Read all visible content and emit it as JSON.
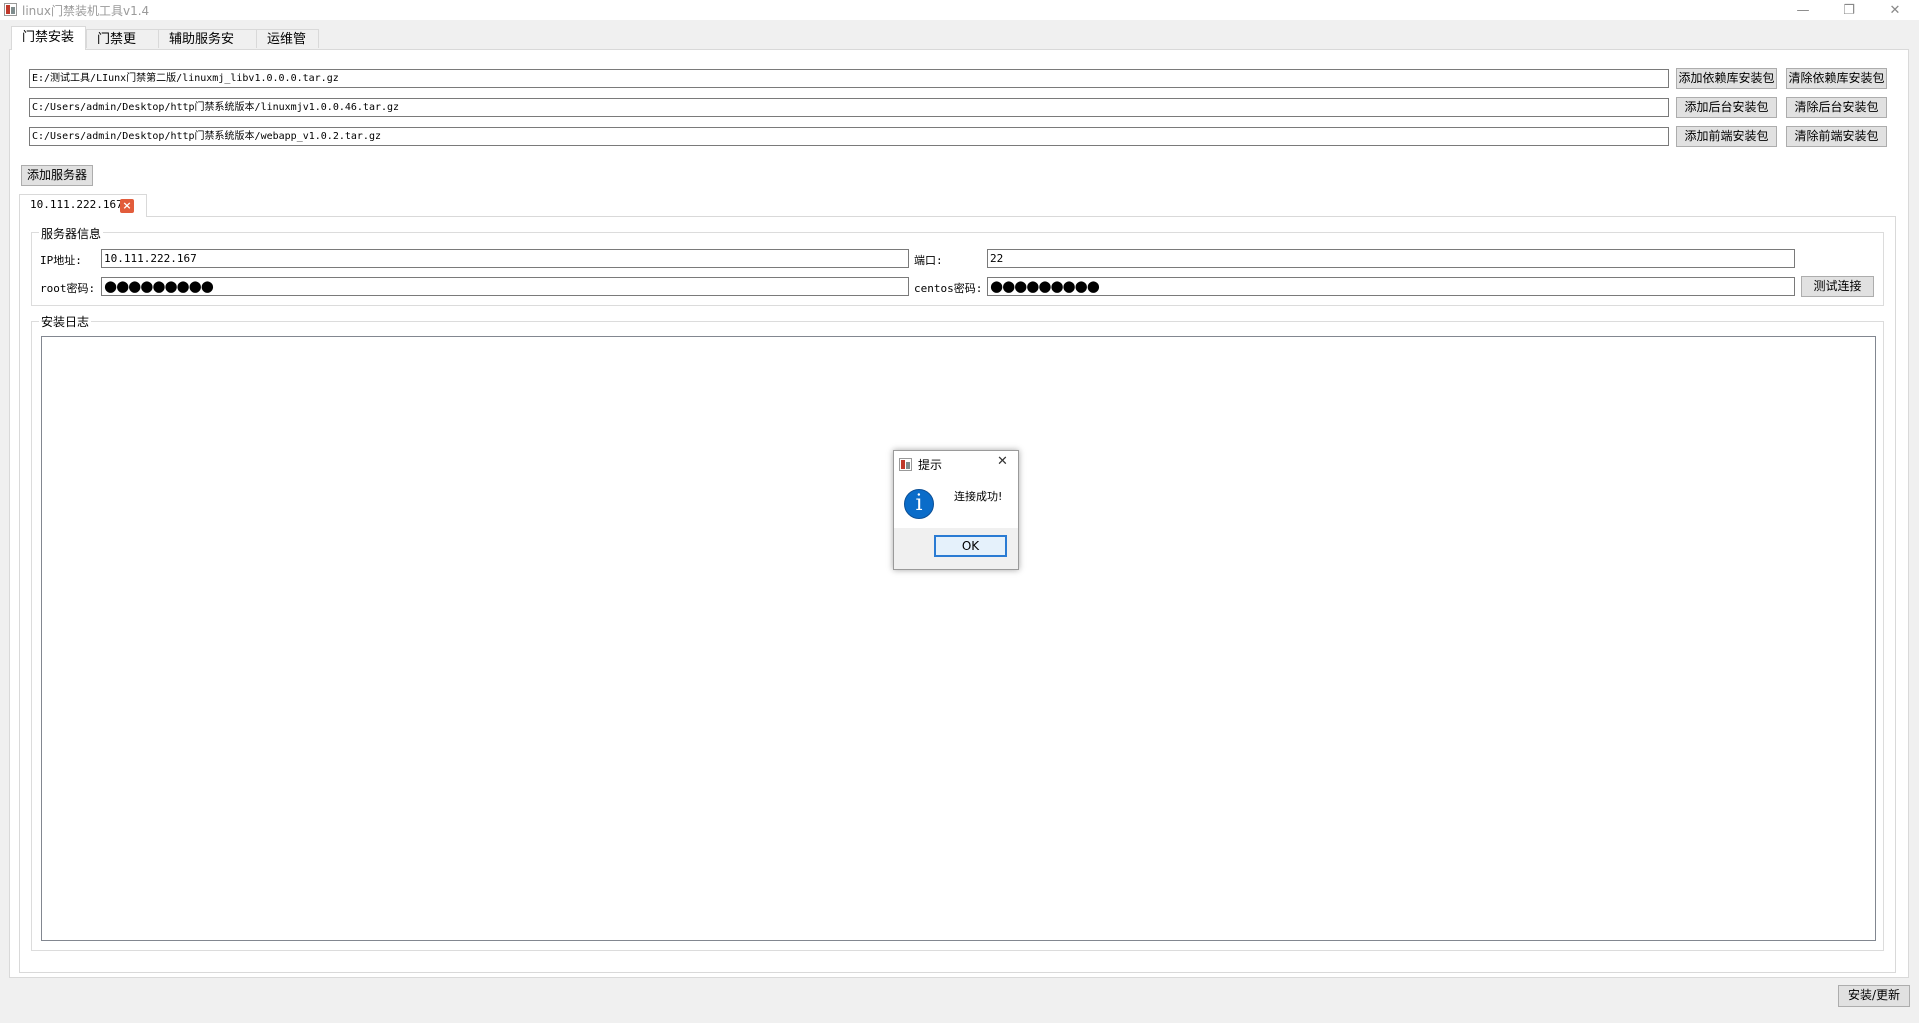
{
  "window": {
    "title": "linux门禁装机工具v1.4",
    "controls": {
      "minimize": "—",
      "restore": "❐",
      "close": "✕"
    }
  },
  "tabs": [
    "门禁安装",
    "门禁更新",
    "辅助服务安装",
    "运维管理"
  ],
  "packages": [
    {
      "path": "E:/测试工具/LIunx门禁第二版/linuxmj_libv1.0.0.0.tar.gz",
      "add_label": "添加依赖库安装包",
      "clear_label": "清除依赖库安装包"
    },
    {
      "path": "C:/Users/admin/Desktop/http门禁系统版本/linuxmjv1.0.0.46.tar.gz",
      "add_label": "添加后台安装包",
      "clear_label": "清除后台安装包"
    },
    {
      "path": "C:/Users/admin/Desktop/http门禁系统版本/webapp_v1.0.2.tar.gz",
      "add_label": "添加前端安装包",
      "clear_label": "清除前端安装包"
    }
  ],
  "add_server_label": "添加服务器",
  "server_tab": {
    "label": "10.111.222.167",
    "close_icon": "close-icon"
  },
  "server_info": {
    "title": "服务器信息",
    "ip_label": "IP地址:",
    "ip_value": "10.111.222.167",
    "port_label": "端口:",
    "port_value": "22",
    "root_pwd_label": "root密码:",
    "root_pwd_value": "●●●●●●●●●",
    "centos_pwd_label": "centos密码:",
    "centos_pwd_value": "●●●●●●●●●",
    "test_button": "测试连接"
  },
  "install_log": {
    "title": "安装日志",
    "content": ""
  },
  "install_button": "安装/更新",
  "dialog": {
    "title": "提示",
    "message": "连接成功!",
    "ok_label": "OK",
    "icon": "info-icon",
    "close": "✕"
  }
}
